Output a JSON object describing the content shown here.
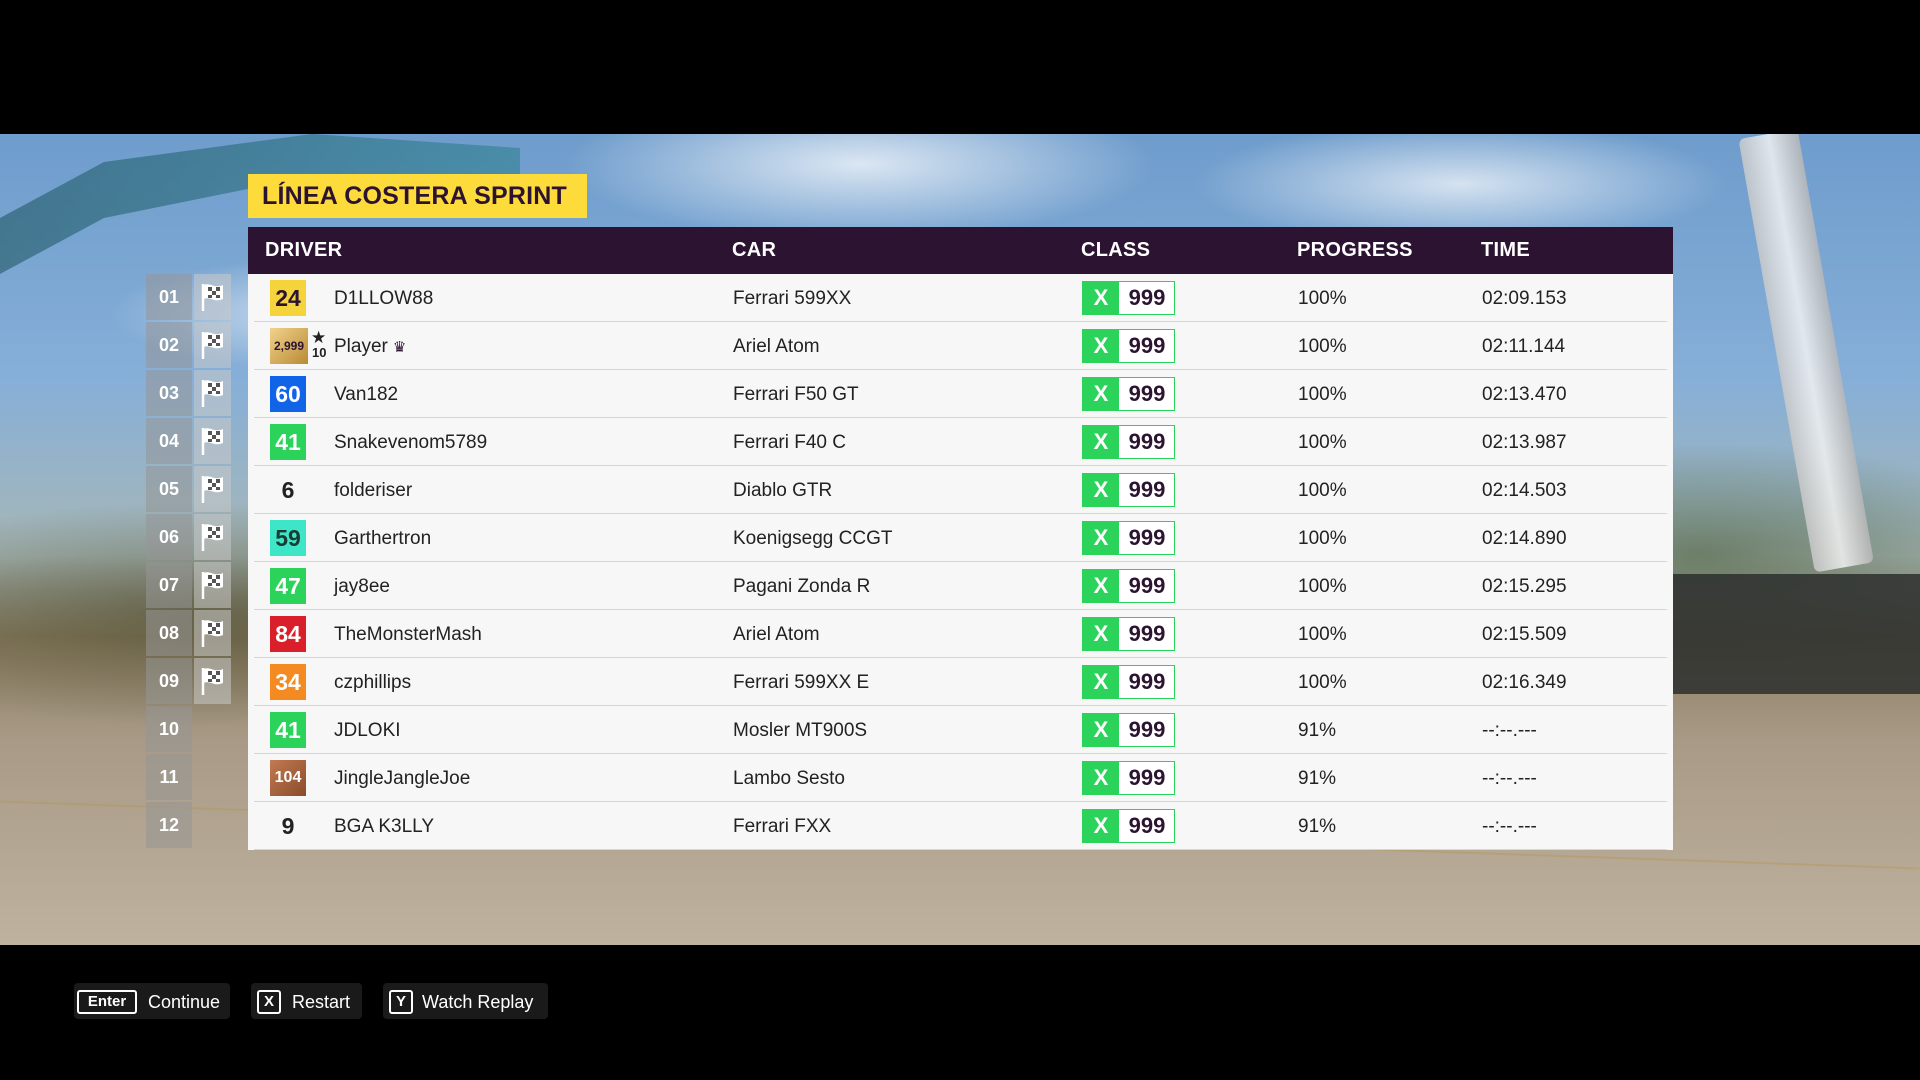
{
  "race": {
    "title": "LÍNEA COSTERA SPRINT"
  },
  "table": {
    "headers": {
      "driver": "DRIVER",
      "car": "CAR",
      "class": "CLASS",
      "progress": "PROGRESS",
      "time": "TIME"
    },
    "rows": [
      {
        "position": "01",
        "level": "24",
        "level_color": "#f5d43b",
        "driver": "D1LLOW88",
        "car": "Ferrari 599XX",
        "class_letter": "X",
        "class_value": "999",
        "progress": "100%",
        "time": "02:09.153"
      },
      {
        "position": "02",
        "level": "2,999",
        "level_color": "#c9a24a",
        "star_level": "10",
        "driver": "Player",
        "car": "Ariel Atom",
        "class_letter": "X",
        "class_value": "999",
        "progress": "100%",
        "time": "02:11.144"
      },
      {
        "position": "03",
        "level": "60",
        "level_color": "#1164e8",
        "driver": "Van182",
        "car": "Ferrari F50 GT",
        "class_letter": "X",
        "class_value": "999",
        "progress": "100%",
        "time": "02:13.470"
      },
      {
        "position": "04",
        "level": "41",
        "level_color": "#2bd35a",
        "driver": "Snakevenom5789",
        "car": "Ferrari F40 C",
        "class_letter": "X",
        "class_value": "999",
        "progress": "100%",
        "time": "02:13.987"
      },
      {
        "position": "05",
        "level": "6",
        "level_color": "transparent",
        "driver": "folderiser",
        "car": "Diablo GTR",
        "class_letter": "X",
        "class_value": "999",
        "progress": "100%",
        "time": "02:14.503"
      },
      {
        "position": "06",
        "level": "59",
        "level_color": "#3ee6c8",
        "driver": "Garthertron",
        "car": "Koenigsegg CCGT",
        "class_letter": "X",
        "class_value": "999",
        "progress": "100%",
        "time": "02:14.890"
      },
      {
        "position": "07",
        "level": "47",
        "level_color": "#2bd35a",
        "driver": "jay8ee",
        "car": "Pagani Zonda R",
        "class_letter": "X",
        "class_value": "999",
        "progress": "100%",
        "time": "02:15.295"
      },
      {
        "position": "08",
        "level": "84",
        "level_color": "#d81f2a",
        "driver": "TheMonsterMash",
        "car": "Ariel Atom",
        "class_letter": "X",
        "class_value": "999",
        "progress": "100%",
        "time": "02:15.509"
      },
      {
        "position": "09",
        "level": "34",
        "level_color": "#f48a22",
        "driver": "czphillips",
        "car": "Ferrari 599XX E",
        "class_letter": "X",
        "class_value": "999",
        "progress": "100%",
        "time": "02:16.349"
      },
      {
        "position": "10",
        "level": "41",
        "level_color": "#2bd35a",
        "driver": "JDLOKI",
        "car": "Mosler MT900S",
        "class_letter": "X",
        "class_value": "999",
        "progress": "91%",
        "time": "--:--.---"
      },
      {
        "position": "11",
        "level": "104",
        "level_color": "#a8623d",
        "driver": "JingleJangleJoe",
        "car": "Lambo Sesto",
        "class_letter": "X",
        "class_value": "999",
        "progress": "91%",
        "time": "--:--.---"
      },
      {
        "position": "12",
        "level": "9",
        "level_color": "transparent",
        "driver": "BGA K3LLY",
        "car": "Ferrari FXX",
        "class_letter": "X",
        "class_value": "999",
        "progress": "91%",
        "time": "--:--.---"
      }
    ]
  },
  "footer": {
    "continue": {
      "key": "Enter",
      "label": "Continue"
    },
    "restart": {
      "key": "X",
      "label": "Restart"
    },
    "replay": {
      "key": "Y",
      "label": "Watch Replay"
    }
  },
  "icons": {
    "flag": "checkered-flag-icon",
    "star": "star-icon",
    "crown": "crown-icon"
  },
  "colors": {
    "header_bg": "#2b1331",
    "title_bg": "#fddb3a",
    "class_x": "#2bd35a"
  }
}
